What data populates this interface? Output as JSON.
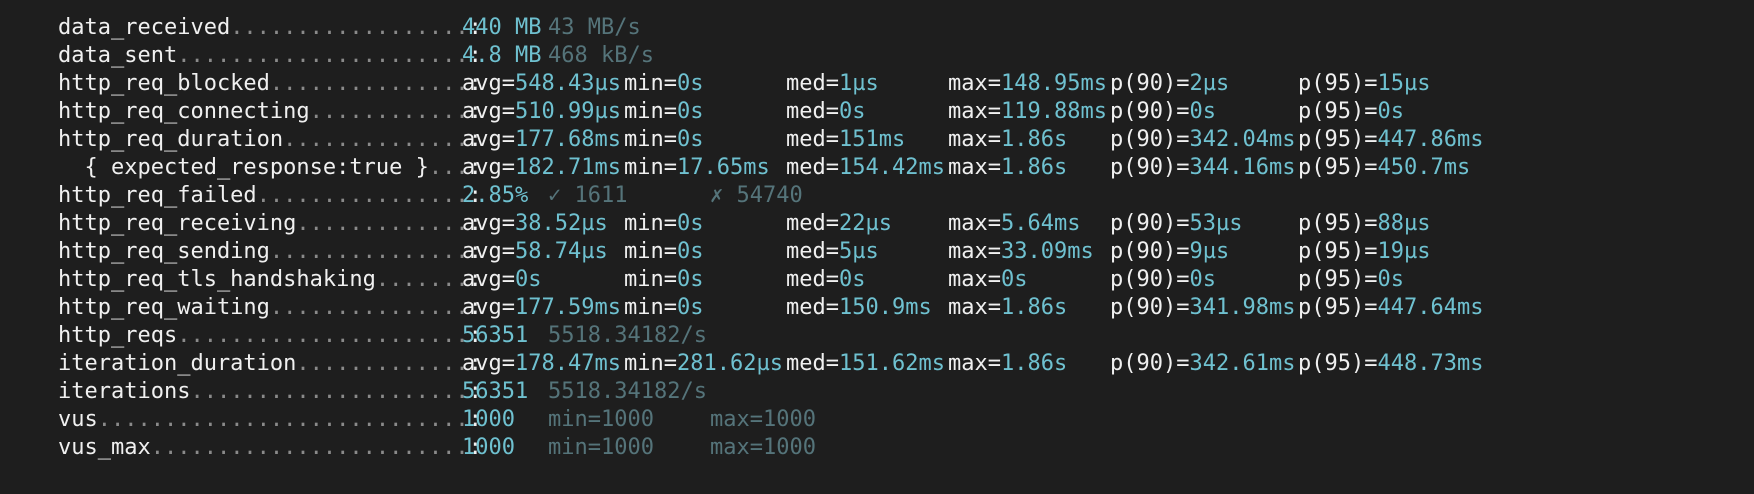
{
  "rows": [
    {
      "label": "data_received",
      "dots": "..................",
      "colon": ":",
      "cells": [
        {
          "k": "",
          "v": "440 MB"
        },
        {
          "k": "",
          "v": "43 MB/s",
          "dim": true
        }
      ]
    },
    {
      "label": "data_sent",
      "dots": "......................",
      "colon": ":",
      "cells": [
        {
          "k": "",
          "v": "4.8 MB"
        },
        {
          "k": "",
          "v": "468 kB/s",
          "dim": true
        }
      ]
    },
    {
      "label": "http_req_blocked",
      "dots": "...............",
      "colon": ":",
      "cells": [
        {
          "k": "avg=",
          "v": "548.43µs"
        },
        {
          "k": "min=",
          "v": "0s"
        },
        {
          "k": "med=",
          "v": "1µs"
        },
        {
          "k": "max=",
          "v": "148.95ms"
        },
        {
          "k": "p(90)=",
          "v": "2µs"
        },
        {
          "k": "p(95)=",
          "v": "15µs"
        }
      ]
    },
    {
      "label": "http_req_connecting",
      "dots": "............",
      "colon": ":",
      "cells": [
        {
          "k": "avg=",
          "v": "510.99µs"
        },
        {
          "k": "min=",
          "v": "0s"
        },
        {
          "k": "med=",
          "v": "0s"
        },
        {
          "k": "max=",
          "v": "119.88ms"
        },
        {
          "k": "p(90)=",
          "v": "0s"
        },
        {
          "k": "p(95)=",
          "v": "0s"
        }
      ]
    },
    {
      "label": "http_req_duration",
      "dots": "..............",
      "colon": ":",
      "cells": [
        {
          "k": "avg=",
          "v": "177.68ms"
        },
        {
          "k": "min=",
          "v": "0s"
        },
        {
          "k": "med=",
          "v": "151ms"
        },
        {
          "k": "max=",
          "v": "1.86s"
        },
        {
          "k": "p(90)=",
          "v": "342.04ms"
        },
        {
          "k": "p(95)=",
          "v": "447.86ms"
        }
      ]
    },
    {
      "label": "  { expected_response:true }",
      "dots": "...",
      "colon": ":",
      "cells": [
        {
          "k": "avg=",
          "v": "182.71ms"
        },
        {
          "k": "min=",
          "v": "17.65ms"
        },
        {
          "k": "med=",
          "v": "154.42ms"
        },
        {
          "k": "max=",
          "v": "1.86s"
        },
        {
          "k": "p(90)=",
          "v": "344.16ms"
        },
        {
          "k": "p(95)=",
          "v": "450.7ms"
        }
      ]
    },
    {
      "label": "http_req_failed",
      "dots": "................",
      "colon": ":",
      "cells": [
        {
          "k": "",
          "v": "2.85%"
        },
        {
          "k": "",
          "v": "✓ 1611",
          "dim": true
        },
        {
          "k": "",
          "v": "✗ 54740",
          "dim": true
        }
      ]
    },
    {
      "label": "http_req_receiving",
      "dots": ".............",
      "colon": ":",
      "cells": [
        {
          "k": "avg=",
          "v": "38.52µs"
        },
        {
          "k": "min=",
          "v": "0s"
        },
        {
          "k": "med=",
          "v": "22µs"
        },
        {
          "k": "max=",
          "v": "5.64ms"
        },
        {
          "k": "p(90)=",
          "v": "53µs"
        },
        {
          "k": "p(95)=",
          "v": "88µs"
        }
      ]
    },
    {
      "label": "http_req_sending",
      "dots": "...............",
      "colon": ":",
      "cells": [
        {
          "k": "avg=",
          "v": "58.74µs"
        },
        {
          "k": "min=",
          "v": "0s"
        },
        {
          "k": "med=",
          "v": "5µs"
        },
        {
          "k": "max=",
          "v": "33.09ms"
        },
        {
          "k": "p(90)=",
          "v": "9µs"
        },
        {
          "k": "p(95)=",
          "v": "19µs"
        }
      ]
    },
    {
      "label": "http_req_tls_handshaking",
      "dots": ".......",
      "colon": ":",
      "cells": [
        {
          "k": "avg=",
          "v": "0s"
        },
        {
          "k": "min=",
          "v": "0s"
        },
        {
          "k": "med=",
          "v": "0s"
        },
        {
          "k": "max=",
          "v": "0s"
        },
        {
          "k": "p(90)=",
          "v": "0s"
        },
        {
          "k": "p(95)=",
          "v": "0s"
        }
      ]
    },
    {
      "label": "http_req_waiting",
      "dots": "...............",
      "colon": ":",
      "cells": [
        {
          "k": "avg=",
          "v": "177.59ms"
        },
        {
          "k": "min=",
          "v": "0s"
        },
        {
          "k": "med=",
          "v": "150.9ms"
        },
        {
          "k": "max=",
          "v": "1.86s"
        },
        {
          "k": "p(90)=",
          "v": "341.98ms"
        },
        {
          "k": "p(95)=",
          "v": "447.64ms"
        }
      ]
    },
    {
      "label": "http_reqs",
      "dots": "......................",
      "colon": ":",
      "cells": [
        {
          "k": "",
          "v": "56351"
        },
        {
          "k": "",
          "v": "5518.34182/s",
          "dim": true
        }
      ]
    },
    {
      "label": "iteration_duration",
      "dots": ".............",
      "colon": ":",
      "cells": [
        {
          "k": "avg=",
          "v": "178.47ms"
        },
        {
          "k": "min=",
          "v": "281.62µs"
        },
        {
          "k": "med=",
          "v": "151.62ms"
        },
        {
          "k": "max=",
          "v": "1.86s"
        },
        {
          "k": "p(90)=",
          "v": "342.61ms"
        },
        {
          "k": "p(95)=",
          "v": "448.73ms"
        }
      ]
    },
    {
      "label": "iterations",
      "dots": ".....................",
      "colon": ":",
      "cells": [
        {
          "k": "",
          "v": "56351"
        },
        {
          "k": "",
          "v": "5518.34182/s",
          "dim": true
        }
      ]
    },
    {
      "label": "vus",
      "dots": "............................",
      "colon": ":",
      "cells": [
        {
          "k": "",
          "v": "1000"
        },
        {
          "k": "",
          "v": "min=1000",
          "dim": true
        },
        {
          "k": "",
          "v": "max=1000",
          "dim": true
        }
      ]
    },
    {
      "label": "vus_max",
      "dots": "........................",
      "colon": ":",
      "cells": [
        {
          "k": "",
          "v": "1000"
        },
        {
          "k": "",
          "v": "min=1000",
          "dim": true
        },
        {
          "k": "",
          "v": "max=1000",
          "dim": true
        }
      ]
    }
  ],
  "colors": {
    "background": "#1e1e1e",
    "label": "#f0f0f0",
    "value": "#6fc1d0",
    "dim": "#55747a"
  }
}
